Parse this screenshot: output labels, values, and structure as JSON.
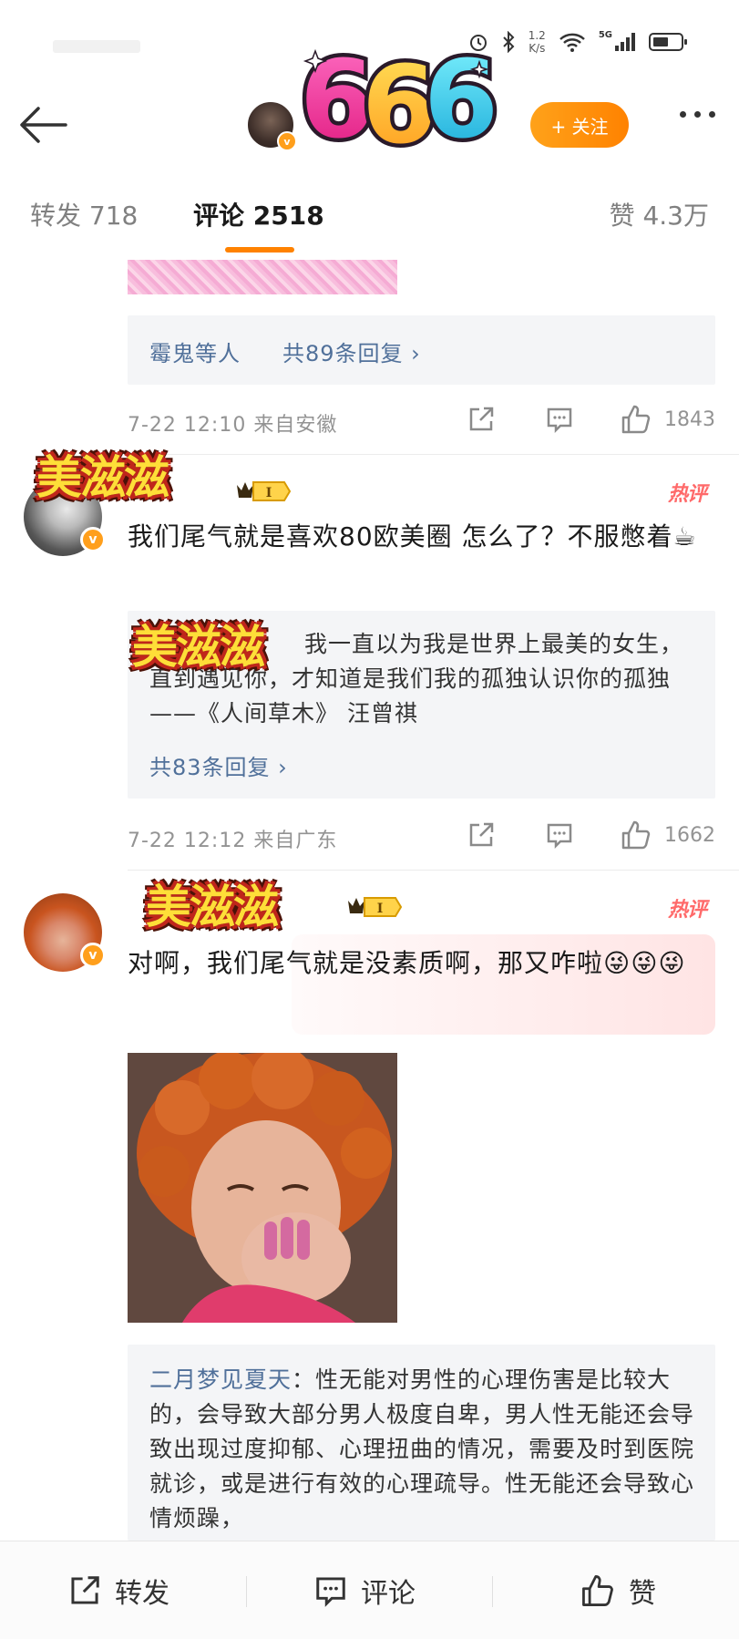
{
  "status_bar": {
    "speed_value": "1.2",
    "speed_unit": "K/s",
    "network": "5G"
  },
  "header": {
    "avatar_label": "user avatar",
    "follow_label": "+ 关注",
    "sticker_text": "666"
  },
  "tabs": [
    {
      "label": "转发 718"
    },
    {
      "label": "评论 2518"
    },
    {
      "label": "赞 4.3万"
    }
  ],
  "comments": [
    {
      "reply_preview": {
        "names": "霉鬼等人",
        "count_text": "共89条回复 ›"
      },
      "time": "7-22 12:10 来自安徽",
      "likes": "1843"
    },
    {
      "nick_sticker": "美滋滋",
      "badge": "I",
      "hot_label": "热评",
      "text": "我们尾气就是喜欢80欧美圈 怎么了？不服憋着☕",
      "reply_box": {
        "sticker": "美滋滋",
        "body": "我一直以为我是世界上最美的女生，直到遇见你，才知道是我们我的孤独认识你的孤独 ——《人间草木》 汪曾祺",
        "count_text": "共83条回复 ›"
      },
      "time": "7-22 12:12 来自广东",
      "likes": "1662"
    },
    {
      "nick_sticker": "美滋滋",
      "badge": "I",
      "hot_label": "热评",
      "text": "对啊，我们尾气就是没素质啊，那又咋啦😜😜😜",
      "image_label": "photo of person with orange curly hair covering mouth",
      "reply_box": {
        "name": "二月梦见夏天",
        "body": "：性无能对男性的心理伤害是比较大的，会导致大部分男人极度自卑，男人性无能还会导致出现过度抑郁、心理扭曲的情况，需要及时到医院就诊，或是进行有效的心理疏导。性无能还会导致心情烦躁，"
      }
    }
  ],
  "bottom_bar": {
    "repost": "转发",
    "comment": "评论",
    "like": "赞"
  },
  "colors": {
    "accent": "#ff8200",
    "link": "#50709a",
    "hot": "#ff6a6a",
    "reply_bg": "#f4f5f7"
  }
}
